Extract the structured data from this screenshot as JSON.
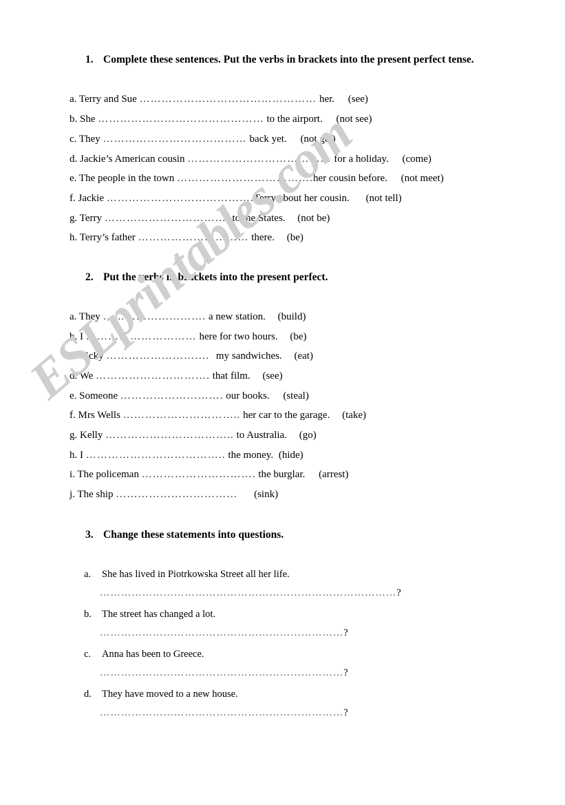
{
  "page": {
    "background": "#ffffff",
    "text_color": "#000000"
  },
  "watermark": {
    "text": "ESLprintables.com",
    "color": "#cfcfcf",
    "rotation_deg": -40.5
  },
  "exercise1": {
    "number": "1.",
    "heading": "Complete these sentences. Put the verbs in brackets into the present perfect tense.",
    "items": [
      {
        "label": "a.",
        "before": "Terry and Sue",
        "dots": "…………………………………………",
        "after": "her.",
        "verb": "(see)"
      },
      {
        "label": "b.",
        "before": "She",
        "dots": "………………………………………",
        "after": "to the airport.",
        "verb": "(not see)"
      },
      {
        "label": "c.",
        "before": "They",
        "dots": "…………………………………",
        "after": "back yet.",
        "verb": "(not get)"
      },
      {
        "label": "d.",
        "before": "Jackie’s American cousin",
        "dots": "…………………………………",
        "after": "for a holiday.",
        "verb": "(come)"
      },
      {
        "label": "e.",
        "before": "The people in the town",
        "dots": "……………………………….",
        "after": "her cousin before.",
        "verb": "(not meet)"
      },
      {
        "label": "f.",
        "before": "Jackie",
        "dots": "………………………………….",
        "after": "Terry about her cousin.",
        "verb": "(not tell)"
      },
      {
        "label": "g.",
        "before": "Terry",
        "dots": "…………………………….",
        "after": "to the States.",
        "verb": "(not be)"
      },
      {
        "label": "h.",
        "before": "Terry’s father",
        "dots": "…………………………",
        "after": "there.",
        "verb": "(be)"
      }
    ]
  },
  "exercise2": {
    "number": "2.",
    "heading": "Put the verbs in brackets into the present perfect.",
    "items": [
      {
        "label": "a.",
        "before": "They",
        "dots": "……………………….",
        "after": "a new station.",
        "verb": "(build)"
      },
      {
        "label": "b.",
        "before": "I",
        "dots": "…………………………",
        "after": "here for two hours.",
        "verb": "(be)"
      },
      {
        "label": "c.",
        "before": "Vicky",
        "dots": "……………………….",
        "after": "my sandwiches.",
        "verb": "(eat)"
      },
      {
        "label": "d.",
        "before": "We",
        "dots": "………………………….",
        "after": "that film.",
        "verb": "(see)"
      },
      {
        "label": "e.",
        "before": "Someone",
        "dots": "……………………….",
        "after": "our books.",
        "verb": "(steal)"
      },
      {
        "label": "f.",
        "before": "Mrs Wells",
        "dots": "…………………………..",
        "after": "her car to the garage.",
        "verb": "(take)"
      },
      {
        "label": "g.",
        "before": "Kelly",
        "dots": "……………………………..",
        "after": "to Australia.",
        "verb": "(go)"
      },
      {
        "label": "h.",
        "before": "I",
        "dots": "………………………………..",
        "after": "the money.",
        "verb": "(hide)"
      },
      {
        "label": "i.",
        "before": "The policeman",
        "dots": "………………………….",
        "after": "the burglar.",
        "verb": "(arrest)"
      },
      {
        "label": "j.",
        "before": "The ship",
        "dots": "……………………………",
        "after": "",
        "verb": "(sink)"
      }
    ]
  },
  "exercise3": {
    "number": "3.",
    "heading": "Change these statements into questions.",
    "items": [
      {
        "label": "a.",
        "statement": "She has lived in Piotrkowska Street all her life.",
        "dots": "…………………………………………………………………………",
        "question_mark": "?"
      },
      {
        "label": "b.",
        "statement": "The street has changed a lot.",
        "dots": "……………………………………………………………",
        "question_mark": "?"
      },
      {
        "label": "c.",
        "statement": "Anna has been to Greece.",
        "dots": "……………………………………………………………",
        "question_mark": "?"
      },
      {
        "label": "d.",
        "statement": "They have moved to a new house.",
        "dots": "……………………………………………………………",
        "question_mark": "?"
      }
    ]
  }
}
